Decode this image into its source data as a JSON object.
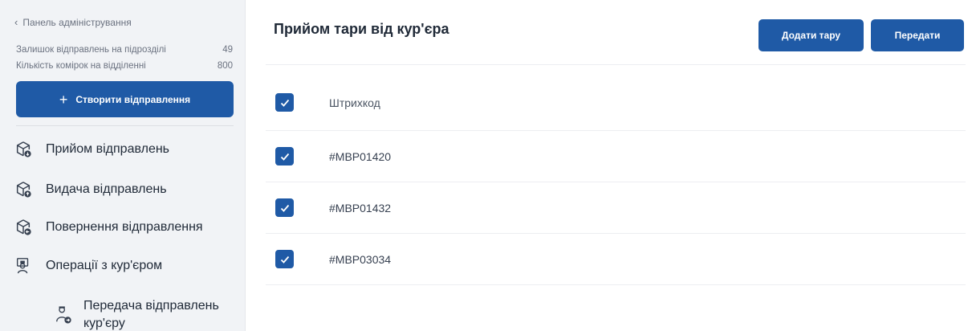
{
  "sidebar": {
    "back_label": "Панель адміністрування",
    "stats": [
      {
        "label": "Залишок відправлень на підрозділі",
        "value": "49"
      },
      {
        "label": "Кількість комірок на відділенні",
        "value": "800"
      }
    ],
    "create_button": "Створити відправлення",
    "nav": [
      {
        "label": "Прийом відправлень",
        "icon": "package-in-icon"
      },
      {
        "label": "Видача відправлень",
        "icon": "package-out-icon"
      },
      {
        "label": "Повернення відправлення",
        "icon": "package-return-icon"
      },
      {
        "label": "Операції з кур'єром",
        "icon": "courier-icon"
      }
    ],
    "sub_item": {
      "line1": "Передача відправлень",
      "line2": "кур'єру",
      "icon": "courier-transfer-icon"
    }
  },
  "main": {
    "title": "Прийом тари від кур'єра",
    "add_button": "Додати тару",
    "send_button": "Передати",
    "column_header": "Штрихкод",
    "rows": [
      {
        "barcode": "#MBP01420",
        "checked": true
      },
      {
        "barcode": "#MBP01432",
        "checked": true
      },
      {
        "barcode": "#MBP03034",
        "checked": true
      }
    ]
  },
  "colors": {
    "accent": "#1f5aa6",
    "sidebar_bg": "#f1f3f6"
  }
}
